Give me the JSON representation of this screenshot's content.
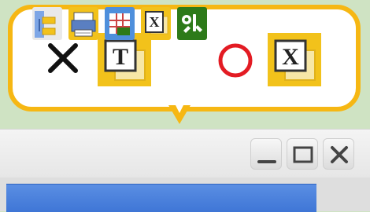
{
  "callout": {
    "bad_mark": "×",
    "good_mark": "○",
    "bad_icon_glyph": "T",
    "good_icon_glyph": "X"
  },
  "toolbar": {
    "buttons": [
      {
        "name": "tree-icon"
      },
      {
        "name": "print-icon"
      },
      {
        "name": "grid-icon"
      },
      {
        "name": "x-icon",
        "glyph": "X"
      },
      {
        "name": "tools-icon"
      }
    ]
  },
  "window_controls": {
    "minimize": "minimize",
    "maximize": "maximize",
    "close": "close"
  },
  "colors": {
    "callout_border": "#f6b713",
    "icon_yellow": "#f2c21b",
    "mark_red": "#e31b23",
    "tools_green": "#2d7a19",
    "content_blue": "#3f76d6"
  }
}
